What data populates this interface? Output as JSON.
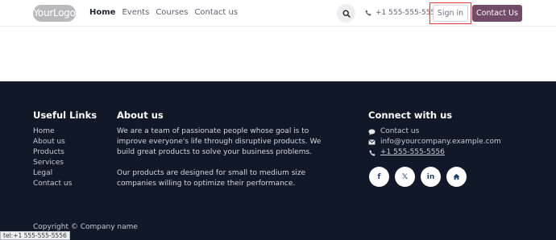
{
  "header": {
    "logo_text": "YourLogo",
    "nav": [
      {
        "label": "Home",
        "active": true
      },
      {
        "label": "Events",
        "active": false
      },
      {
        "label": "Courses",
        "active": false
      },
      {
        "label": "Contact us",
        "active": false
      }
    ],
    "phone": "+1 555-555-5556",
    "signin_label": "Sign in",
    "contact_button_label": "Contact Us"
  },
  "footer": {
    "useful_links_title": "Useful Links",
    "useful_links": [
      "Home",
      "About us",
      "Products",
      "Services",
      "Legal",
      "Contact us"
    ],
    "about_title": "About us",
    "about_p1": "We are a team of passionate people whose goal is to improve everyone's life through disruptive products. We build great products to solve your business problems.",
    "about_p2": "Our products are designed for small to medium size companies willing to optimize their performance.",
    "connect_title": "Connect with us",
    "connect_items": [
      {
        "icon": "chat-icon",
        "text": "Contact us"
      },
      {
        "icon": "envelope-icon",
        "text": "info@yourcompany.example.com"
      },
      {
        "icon": "phone-icon",
        "text": "+1 555-555-5556"
      }
    ],
    "social": [
      {
        "icon": "facebook-icon",
        "glyph": "f"
      },
      {
        "icon": "x-icon",
        "glyph": "𝕏"
      },
      {
        "icon": "linkedin-icon",
        "glyph": "in"
      },
      {
        "icon": "home-icon",
        "glyph": "⌂"
      }
    ],
    "copyright": "Copyright © Company name"
  },
  "status_bar": "tel:+1 555-555-5556",
  "colors": {
    "brand": "#714b67",
    "footer_bg": "#111827",
    "highlight": "#e53935"
  }
}
